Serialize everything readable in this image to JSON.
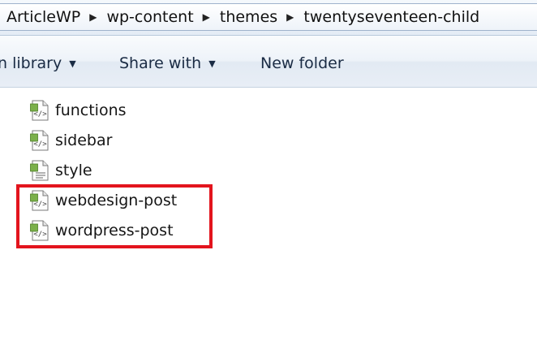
{
  "breadcrumb": {
    "items": [
      "ArticleWP",
      "wp-content",
      "themes",
      "twentyseventeen-child"
    ]
  },
  "toolbar": {
    "library_label": "n library",
    "share_label": "Share with",
    "new_folder_label": "New folder"
  },
  "files": [
    {
      "name": "functions",
      "icon": "php-file-icon"
    },
    {
      "name": "sidebar",
      "icon": "php-file-icon"
    },
    {
      "name": "style",
      "icon": "css-file-icon"
    },
    {
      "name": "webdesign-post",
      "icon": "php-file-icon"
    },
    {
      "name": "wordpress-post",
      "icon": "php-file-icon"
    }
  ],
  "colors": {
    "highlight": "#e3141d",
    "toolbar_text": "#1a2b44"
  }
}
